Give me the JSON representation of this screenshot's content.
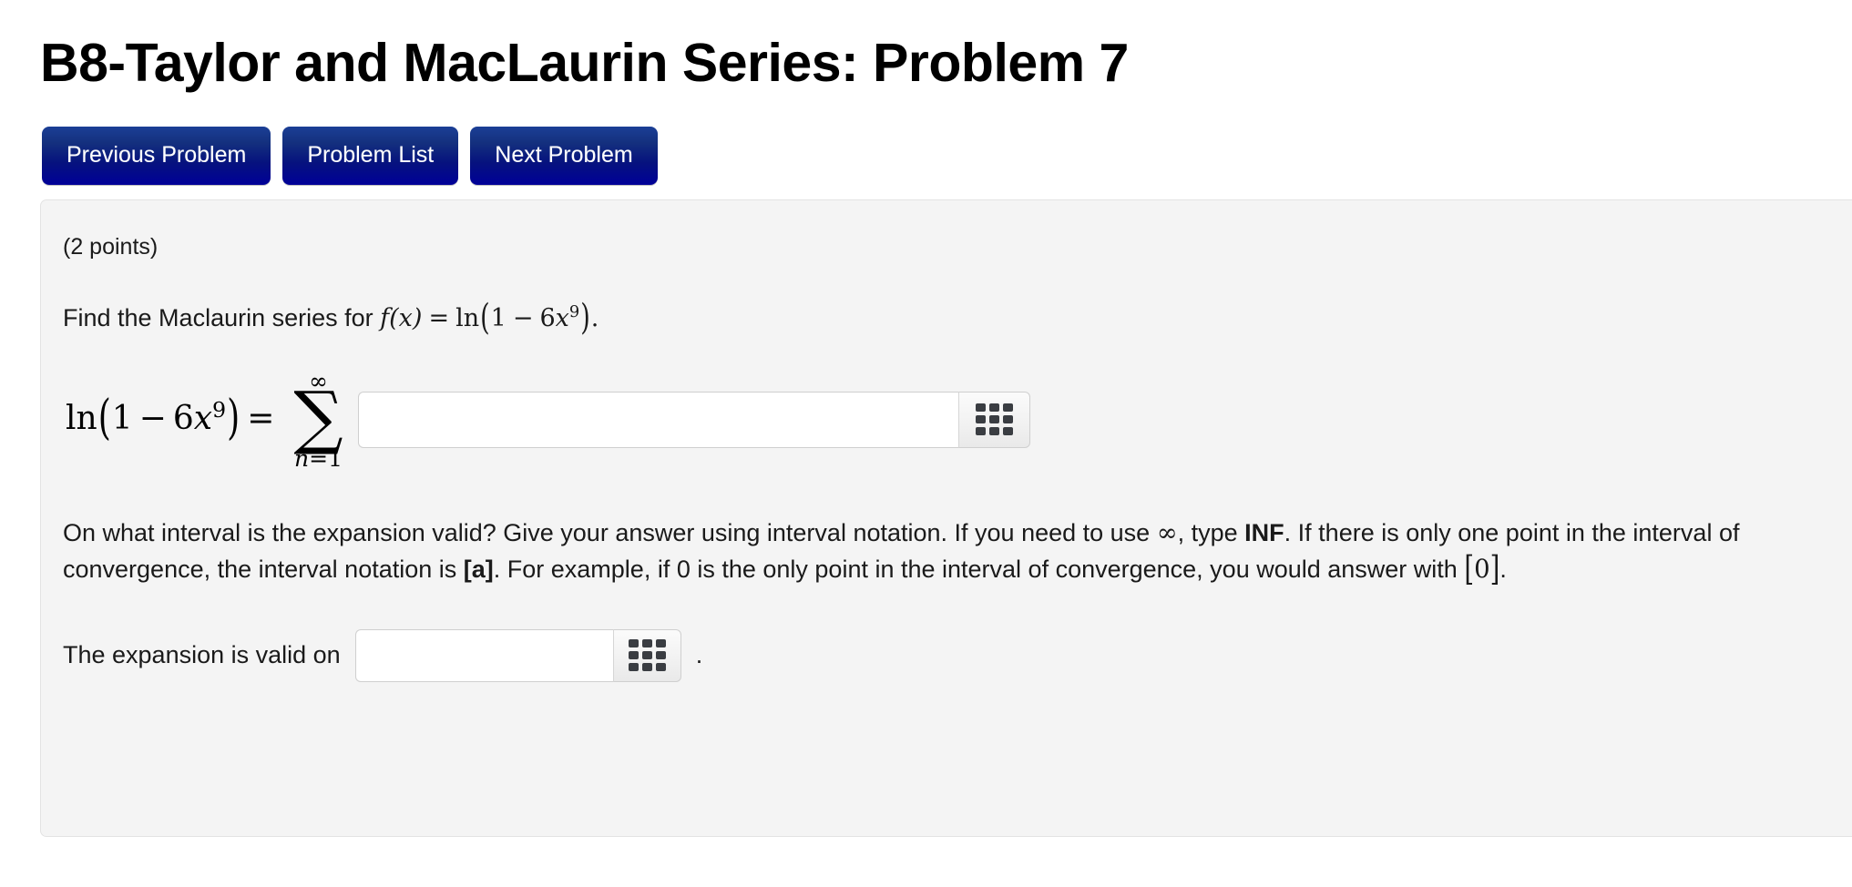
{
  "header": {
    "title": "B8-Taylor and MacLaurin Series: Problem 7"
  },
  "nav": {
    "buttons": [
      {
        "label": "Previous Problem",
        "name": "previous-problem-button"
      },
      {
        "label": "Problem List",
        "name": "problem-list-button"
      },
      {
        "label": "Next Problem",
        "name": "next-problem-button"
      }
    ]
  },
  "problem": {
    "points_text": "(2 points)",
    "prompt": {
      "lead": "Find the Maclaurin series for ",
      "math": {
        "fx": "f(x)",
        "equals": "=",
        "ln": "ln",
        "open_paren": "(",
        "one": "1",
        "minus": "−",
        "coefficient": "6",
        "variable": "x",
        "exponent": "9",
        "close_paren": ")",
        "period": "."
      }
    },
    "equation": {
      "lhs_ln": "ln",
      "lhs_open": "(",
      "lhs_one": "1",
      "lhs_minus": "−",
      "lhs_coefficient": "6",
      "lhs_variable": "x",
      "lhs_exponent": "9",
      "lhs_close": ")",
      "lhs_equals": "=",
      "sum_upper_limit": "∞",
      "sum_symbol": "∑",
      "sum_index": "n",
      "sum_index_equals": "=",
      "sum_lower_value": "1"
    },
    "series_answer": {
      "value": "",
      "placeholder": "",
      "keypad_icon": "keypad-grid-icon"
    },
    "interval_paragraph": {
      "part1": "On what interval is the expansion valid? Give your answer using interval notation. If you need to use ",
      "infinity_symbol": "∞",
      "part2": ", type ",
      "inf_keyword": "INF",
      "part3": ". If there is only one point in the interval of convergence, the interval notation is ",
      "bracket_a": "[a]",
      "part4": ". For example, if 0 is the only point in the interval of convergence, you would answer with ",
      "bracket_zero_open": "[",
      "bracket_zero_value": "0",
      "bracket_zero_close": "]",
      "part5": "."
    },
    "final_answer": {
      "label": "The expansion is valid on",
      "value": "",
      "placeholder": "",
      "keypad_icon": "keypad-grid-icon",
      "trailing_period": "."
    }
  },
  "colors": {
    "button_gradient_top": "#1b3f96",
    "button_gradient_bottom": "#000098",
    "panel_background": "#f4f4f4",
    "panel_border": "#e3e3e3",
    "input_border": "#cfcfcf",
    "keypad_dot": "#3a3d42",
    "page_background": "#ffffff",
    "text": "#1a1a1a"
  }
}
